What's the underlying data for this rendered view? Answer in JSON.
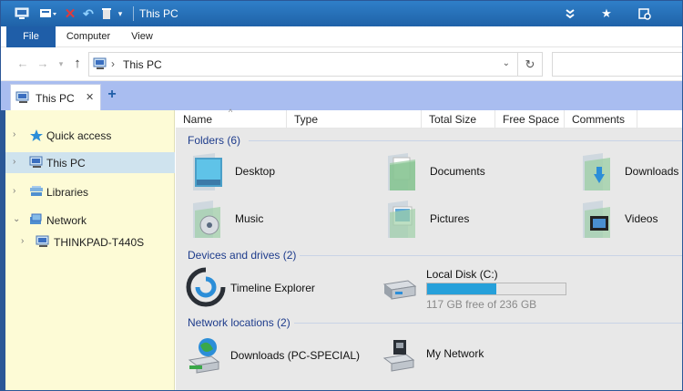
{
  "window": {
    "title": "This PC"
  },
  "ribbon": {
    "tabs": [
      "File",
      "Computer",
      "View"
    ]
  },
  "address": {
    "path": "This PC"
  },
  "tab": {
    "label": "This PC"
  },
  "navigation": {
    "items": [
      {
        "label": "Quick access",
        "icon": "star-icon"
      },
      {
        "label": "This PC",
        "icon": "pc-icon"
      },
      {
        "label": "Libraries",
        "icon": "libraries-icon"
      },
      {
        "label": "Network",
        "icon": "network-icon"
      },
      {
        "label": "THINKPAD-T440S",
        "icon": "computer-icon"
      }
    ]
  },
  "columns": [
    "Name",
    "Type",
    "Total Size",
    "Free Space",
    "Comments"
  ],
  "groups": {
    "folders": {
      "header": "Folders (6)",
      "items": [
        "Desktop",
        "Documents",
        "Downloads",
        "Music",
        "Pictures",
        "Videos"
      ]
    },
    "devices": {
      "header": "Devices and drives (2)",
      "timeline": "Timeline Explorer",
      "disk": {
        "label": "Local Disk (C:)",
        "free_text": "117 GB free of 236 GB",
        "used_fraction": 0.5
      }
    },
    "network": {
      "header": "Network locations (2)",
      "items": [
        "Downloads (PC-SPECIAL)",
        "My Network"
      ]
    }
  },
  "colors": {
    "accent": "#1f5ea8",
    "nav_bg": "#fdfbd6",
    "tabstrip": "#a9bdf0",
    "disk_fill": "#26a0da"
  }
}
